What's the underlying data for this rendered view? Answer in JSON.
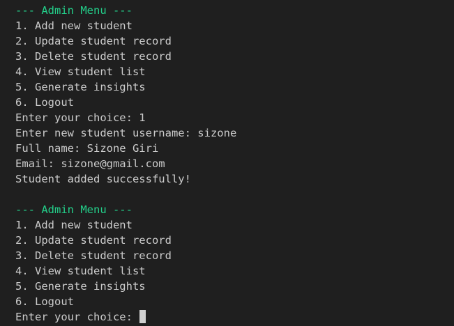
{
  "terminal": {
    "colors": {
      "background": "#1f1f1f",
      "text": "#cccccc",
      "header": "#23d18b",
      "cursor": "#d0d0d0"
    },
    "menu1": {
      "header": "--- Admin Menu ---",
      "items": [
        "1. Add new student",
        "2. Update student record",
        "3. Delete student record",
        "4. View student list",
        "5. Generate insights",
        "6. Logout"
      ]
    },
    "session": {
      "choice_prompt": "Enter your choice: 1",
      "username_prompt": "Enter new student username: sizone",
      "fullname_prompt": "Full name: Sizone Giri",
      "email_prompt": "Email: sizone@gmail.com",
      "result": "Student added successfully!"
    },
    "menu2": {
      "header": "--- Admin Menu ---",
      "items": [
        "1. Add new student",
        "2. Update student record",
        "3. Delete student record",
        "4. View student list",
        "5. Generate insights",
        "6. Logout"
      ],
      "prompt": "Enter your choice: "
    }
  }
}
